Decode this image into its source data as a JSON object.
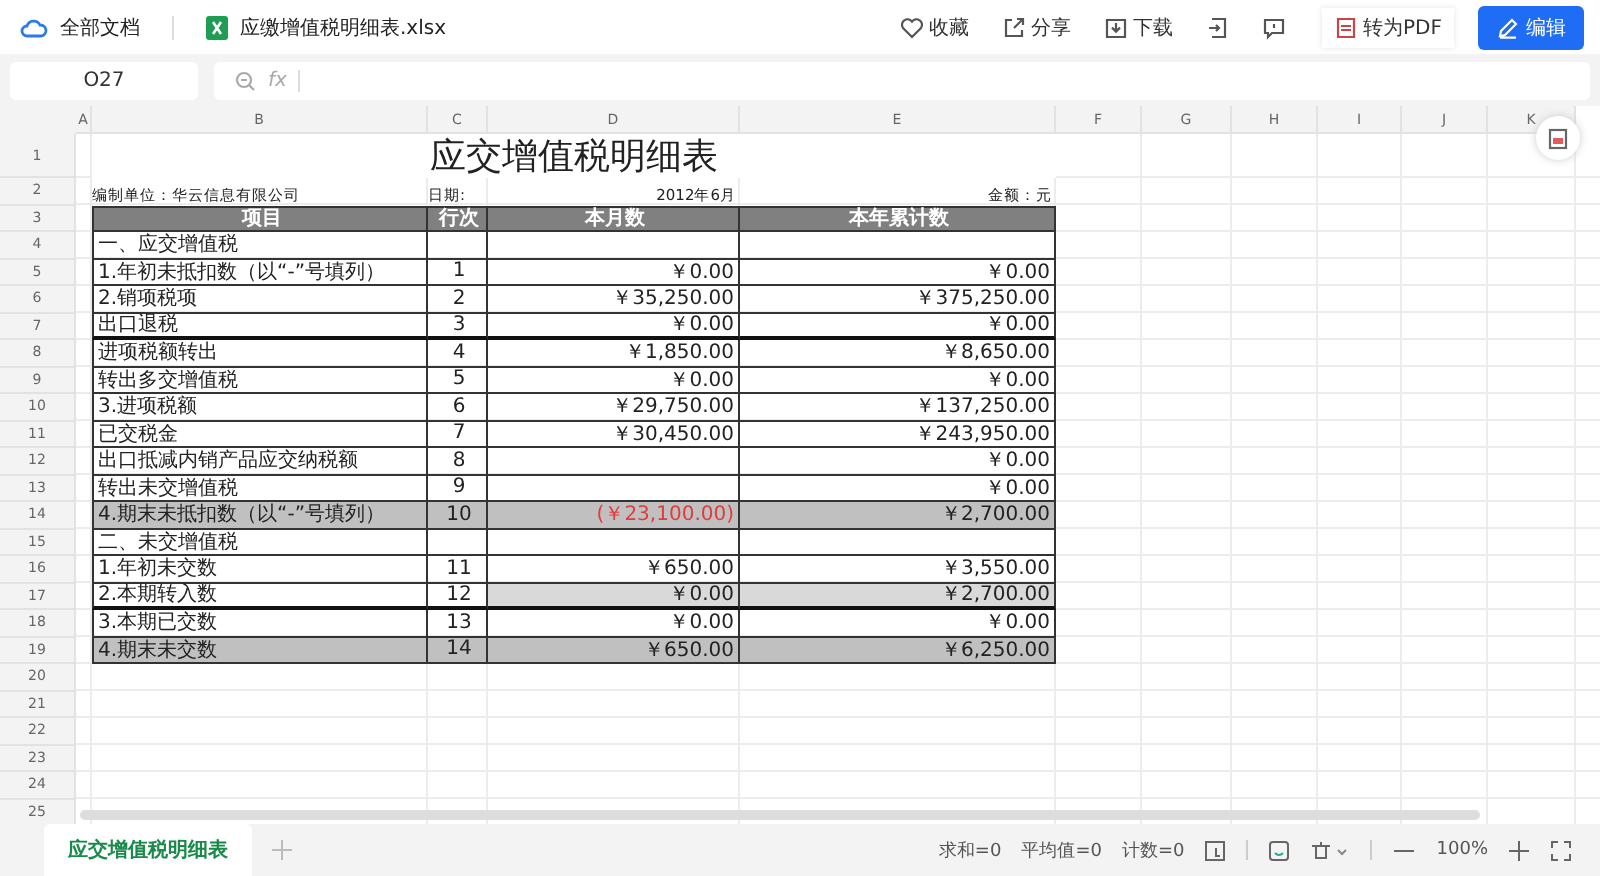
{
  "topbar": {
    "breadcrumb": "全部文档",
    "filename": "应缴增值税明细表.xlsx",
    "actions": [
      {
        "kind": "favorite",
        "label": "收藏"
      },
      {
        "kind": "share",
        "label": "分享"
      },
      {
        "kind": "download",
        "label": "下载"
      },
      {
        "kind": "export"
      },
      {
        "kind": "comment"
      },
      {
        "kind": "pdf",
        "label": "转为PDF"
      },
      {
        "kind": "edit",
        "label": "编辑"
      }
    ]
  },
  "formula_bar": {
    "cell_ref": "O27",
    "fx": "fx"
  },
  "columns": [
    "A",
    "B",
    "C",
    "D",
    "E",
    "F",
    "G",
    "H",
    "I",
    "J",
    "K"
  ],
  "row_numbers": [
    "1",
    "2",
    "3",
    "4",
    "5",
    "6",
    "7",
    "8",
    "9",
    "10",
    "11",
    "12",
    "13",
    "14",
    "15",
    "16",
    "17",
    "18",
    "19",
    "20",
    "21",
    "22",
    "23",
    "24",
    "25"
  ],
  "table": {
    "title": "应交增值税明细表",
    "company": "编制单位：华云信息有限公司",
    "date_label": "日期:",
    "date": "2012年6月",
    "unit": "金额：元",
    "headers": [
      "项目",
      "行次",
      "本月数",
      "本年累计数"
    ],
    "rows": [
      {
        "kind": "plain",
        "item": "一、应交增值税",
        "month_negative": false,
        "thick_bottom": false
      },
      {
        "kind": "plain",
        "item": "1.年初未抵扣数（以“-”号填列）",
        "line": "1",
        "month": "￥0.00",
        "year": "￥0.00",
        "month_negative": false,
        "thick_bottom": false
      },
      {
        "kind": "plain",
        "item": "2.销项税项",
        "line": "2",
        "month": "￥35,250.00",
        "year": "￥375,250.00",
        "month_negative": false,
        "thick_bottom": false
      },
      {
        "kind": "plain",
        "item": "出口退税",
        "line": "3",
        "month": "￥0.00",
        "year": "￥0.00",
        "month_negative": false,
        "thick_bottom": true
      },
      {
        "kind": "plain",
        "item": "进项税额转出",
        "line": "4",
        "month": "￥1,850.00",
        "year": "￥8,650.00",
        "month_negative": false,
        "thick_bottom": false
      },
      {
        "kind": "plain",
        "item": "转出多交增值税",
        "line": "5",
        "month": "￥0.00",
        "year": "￥0.00",
        "month_negative": false,
        "thick_bottom": false
      },
      {
        "kind": "plain",
        "item": "3.进项税额",
        "line": "6",
        "month": "￥29,750.00",
        "year": "￥137,250.00",
        "month_negative": false,
        "thick_bottom": false
      },
      {
        "kind": "plain",
        "item": "已交税金",
        "line": "7",
        "month": "￥30,450.00",
        "year": "￥243,950.00",
        "month_negative": false,
        "thick_bottom": false
      },
      {
        "kind": "plain",
        "item": "出口抵减内销产品应交纳税额",
        "line": "8",
        "year": "￥0.00",
        "month_negative": false,
        "thick_bottom": false
      },
      {
        "kind": "plain",
        "item": "转出未交增值税",
        "line": "9",
        "year": "￥0.00",
        "month_negative": false,
        "thick_bottom": false
      },
      {
        "kind": "total",
        "item": "4.期末未抵扣数（以“-”号填列）",
        "line": "10",
        "month": "(￥23,100.00)",
        "year": "￥2,700.00",
        "month_negative": true,
        "thick_bottom": false
      },
      {
        "kind": "plain",
        "item": "二、未交增值税",
        "month_negative": false,
        "thick_bottom": false
      },
      {
        "kind": "plain",
        "item": "1.年初未交数",
        "line": "11",
        "month": "￥650.00",
        "year": "￥3,550.00",
        "month_negative": false,
        "thick_bottom": false
      },
      {
        "kind": "shaded",
        "item": "2.本期转入数",
        "line": "12",
        "month": "￥0.00",
        "year": "￥2,700.00",
        "month_negative": false,
        "thick_bottom": true
      },
      {
        "kind": "plain",
        "item": "3.本期已交数",
        "line": "13",
        "month": "￥0.00",
        "year": "￥0.00",
        "month_negative": false,
        "thick_bottom": false
      },
      {
        "kind": "total",
        "item": "4.期末未交数",
        "line": "14",
        "month": "￥650.00",
        "year": "￥6,250.00",
        "month_negative": false,
        "thick_bottom": false
      }
    ]
  },
  "sheet_tabs": [
    {
      "label": "应交增值税明细表",
      "selected": true
    }
  ],
  "status_bar": {
    "stats": [
      "求和=0",
      "平均值=0",
      "计数=0"
    ],
    "zoom": "100%"
  }
}
